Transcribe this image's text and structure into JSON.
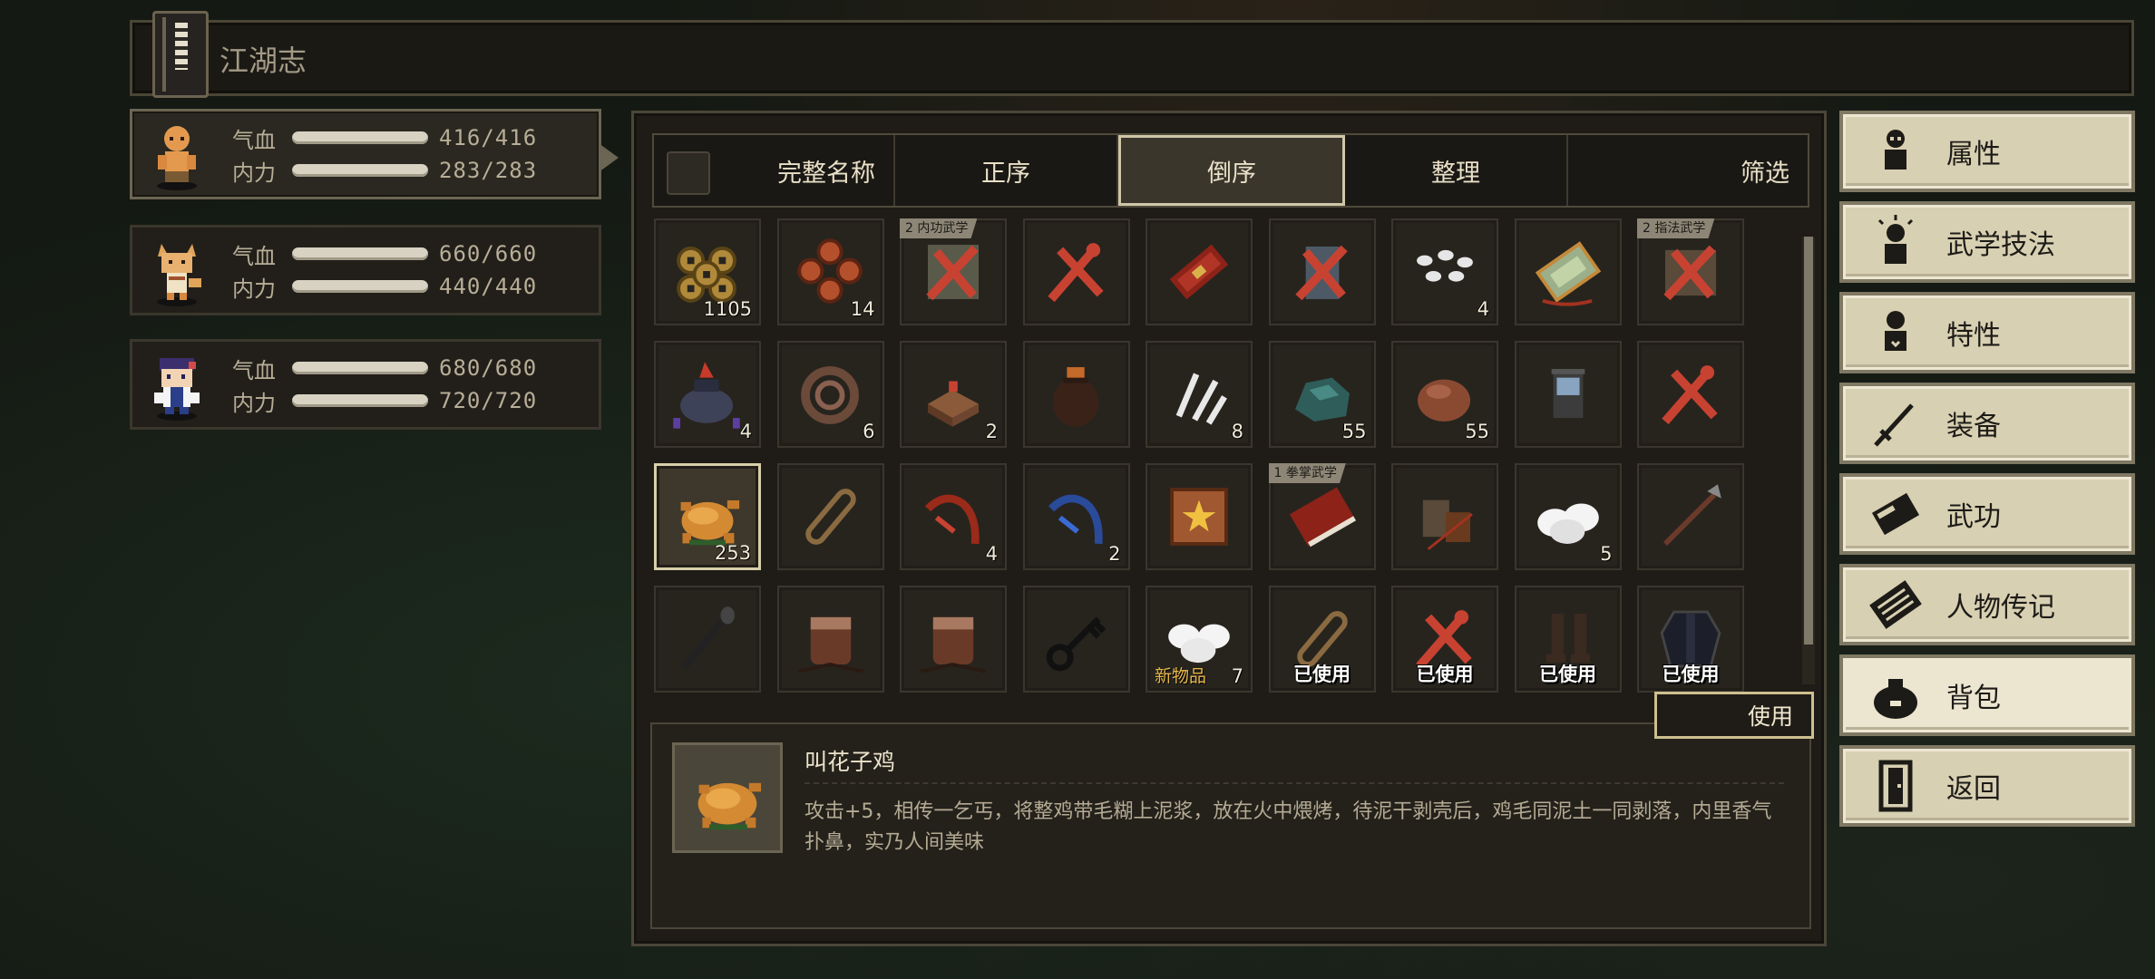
{
  "header": {
    "title": "江湖志",
    "book_icon": "book-icon"
  },
  "party": [
    {
      "hp_label": "气血",
      "hp": "416/416",
      "mp_label": "内力",
      "mp": "283/283",
      "hp_fill": 1.0,
      "mp_fill": 1.0
    },
    {
      "hp_label": "气血",
      "hp": "660/660",
      "mp_label": "内力",
      "mp": "440/440",
      "hp_fill": 1.0,
      "mp_fill": 1.0
    },
    {
      "hp_label": "气血",
      "hp": "680/680",
      "mp_label": "内力",
      "mp": "720/720",
      "hp_fill": 1.0,
      "mp_fill": 1.0
    }
  ],
  "inventory": {
    "tabs": [
      "完整名称",
      "正序",
      "倒序",
      "整理",
      "筛选"
    ],
    "selected_tab": "倒序",
    "items": [
      {
        "icon": "coins-gold-icon",
        "count": "1105"
      },
      {
        "icon": "coins-copper-icon",
        "count": "14"
      },
      {
        "icon": "scroll-crossed-icon",
        "tag": "2 内功武学"
      },
      {
        "icon": "red-x-icon"
      },
      {
        "icon": "red-book-icon"
      },
      {
        "icon": "statue-crossed-icon"
      },
      {
        "icon": "silver-pieces-icon",
        "count": "4"
      },
      {
        "icon": "jade-tablet-icon"
      },
      {
        "icon": "tome-crossed-icon",
        "tag": "2 指法武学"
      },
      {
        "icon": "iron-pot-icon",
        "count": "4"
      },
      {
        "icon": "rope-coil-icon",
        "count": "6"
      },
      {
        "icon": "tofu-icon",
        "count": "2"
      },
      {
        "icon": "wine-jar-icon"
      },
      {
        "icon": "feathers-icon",
        "count": "8"
      },
      {
        "icon": "ore-icon",
        "count": "55"
      },
      {
        "icon": "clay-icon",
        "count": "55"
      },
      {
        "icon": "lantern-icon"
      },
      {
        "icon": "red-x-icon"
      },
      {
        "icon": "roast-chicken-icon",
        "count": "253",
        "selected": true
      },
      {
        "icon": "rope-icon"
      },
      {
        "icon": "red-whip-icon",
        "count": "4"
      },
      {
        "icon": "blue-whip-icon",
        "count": "2"
      },
      {
        "icon": "star-map-icon"
      },
      {
        "icon": "manual-icon",
        "tag": "1 拳掌武学"
      },
      {
        "icon": "bowl-bag-icon"
      },
      {
        "icon": "bun-icon",
        "count": "5"
      },
      {
        "icon": "spear-icon"
      },
      {
        "icon": "brush-icon"
      },
      {
        "icon": "barrel-icon"
      },
      {
        "icon": "barrel-icon"
      },
      {
        "icon": "key-icon"
      },
      {
        "icon": "buns-icon",
        "count": "7",
        "new": "新物品"
      },
      {
        "icon": "rope-icon",
        "used": "已使用"
      },
      {
        "icon": "red-x-icon",
        "used": "已使用"
      },
      {
        "icon": "boots-icon",
        "used": "已使用"
      },
      {
        "icon": "robe-icon",
        "used": "已使用"
      }
    ],
    "use_button": "使用",
    "scroll_position": 0.0
  },
  "detail": {
    "name": "叫花子鸡",
    "desc": "攻击+5，相传一乞丐，将整鸡带毛糊上泥浆，放在火中煨烤，待泥干剥壳后，鸡毛同泥土一同剥落，内里香气扑鼻，实乃人间美味",
    "icon": "roast-chicken-icon"
  },
  "menu": [
    {
      "label": "属性",
      "icon": "person-icon"
    },
    {
      "label": "武学技法",
      "icon": "person-spark-icon"
    },
    {
      "label": "特性",
      "icon": "person-heart-icon"
    },
    {
      "label": "装备",
      "icon": "sword-icon"
    },
    {
      "label": "武功",
      "icon": "martial-book-icon"
    },
    {
      "label": "人物传记",
      "icon": "biography-book-icon"
    },
    {
      "label": "背包",
      "icon": "bag-icon",
      "active": true
    },
    {
      "label": "返回",
      "icon": "door-icon"
    }
  ]
}
